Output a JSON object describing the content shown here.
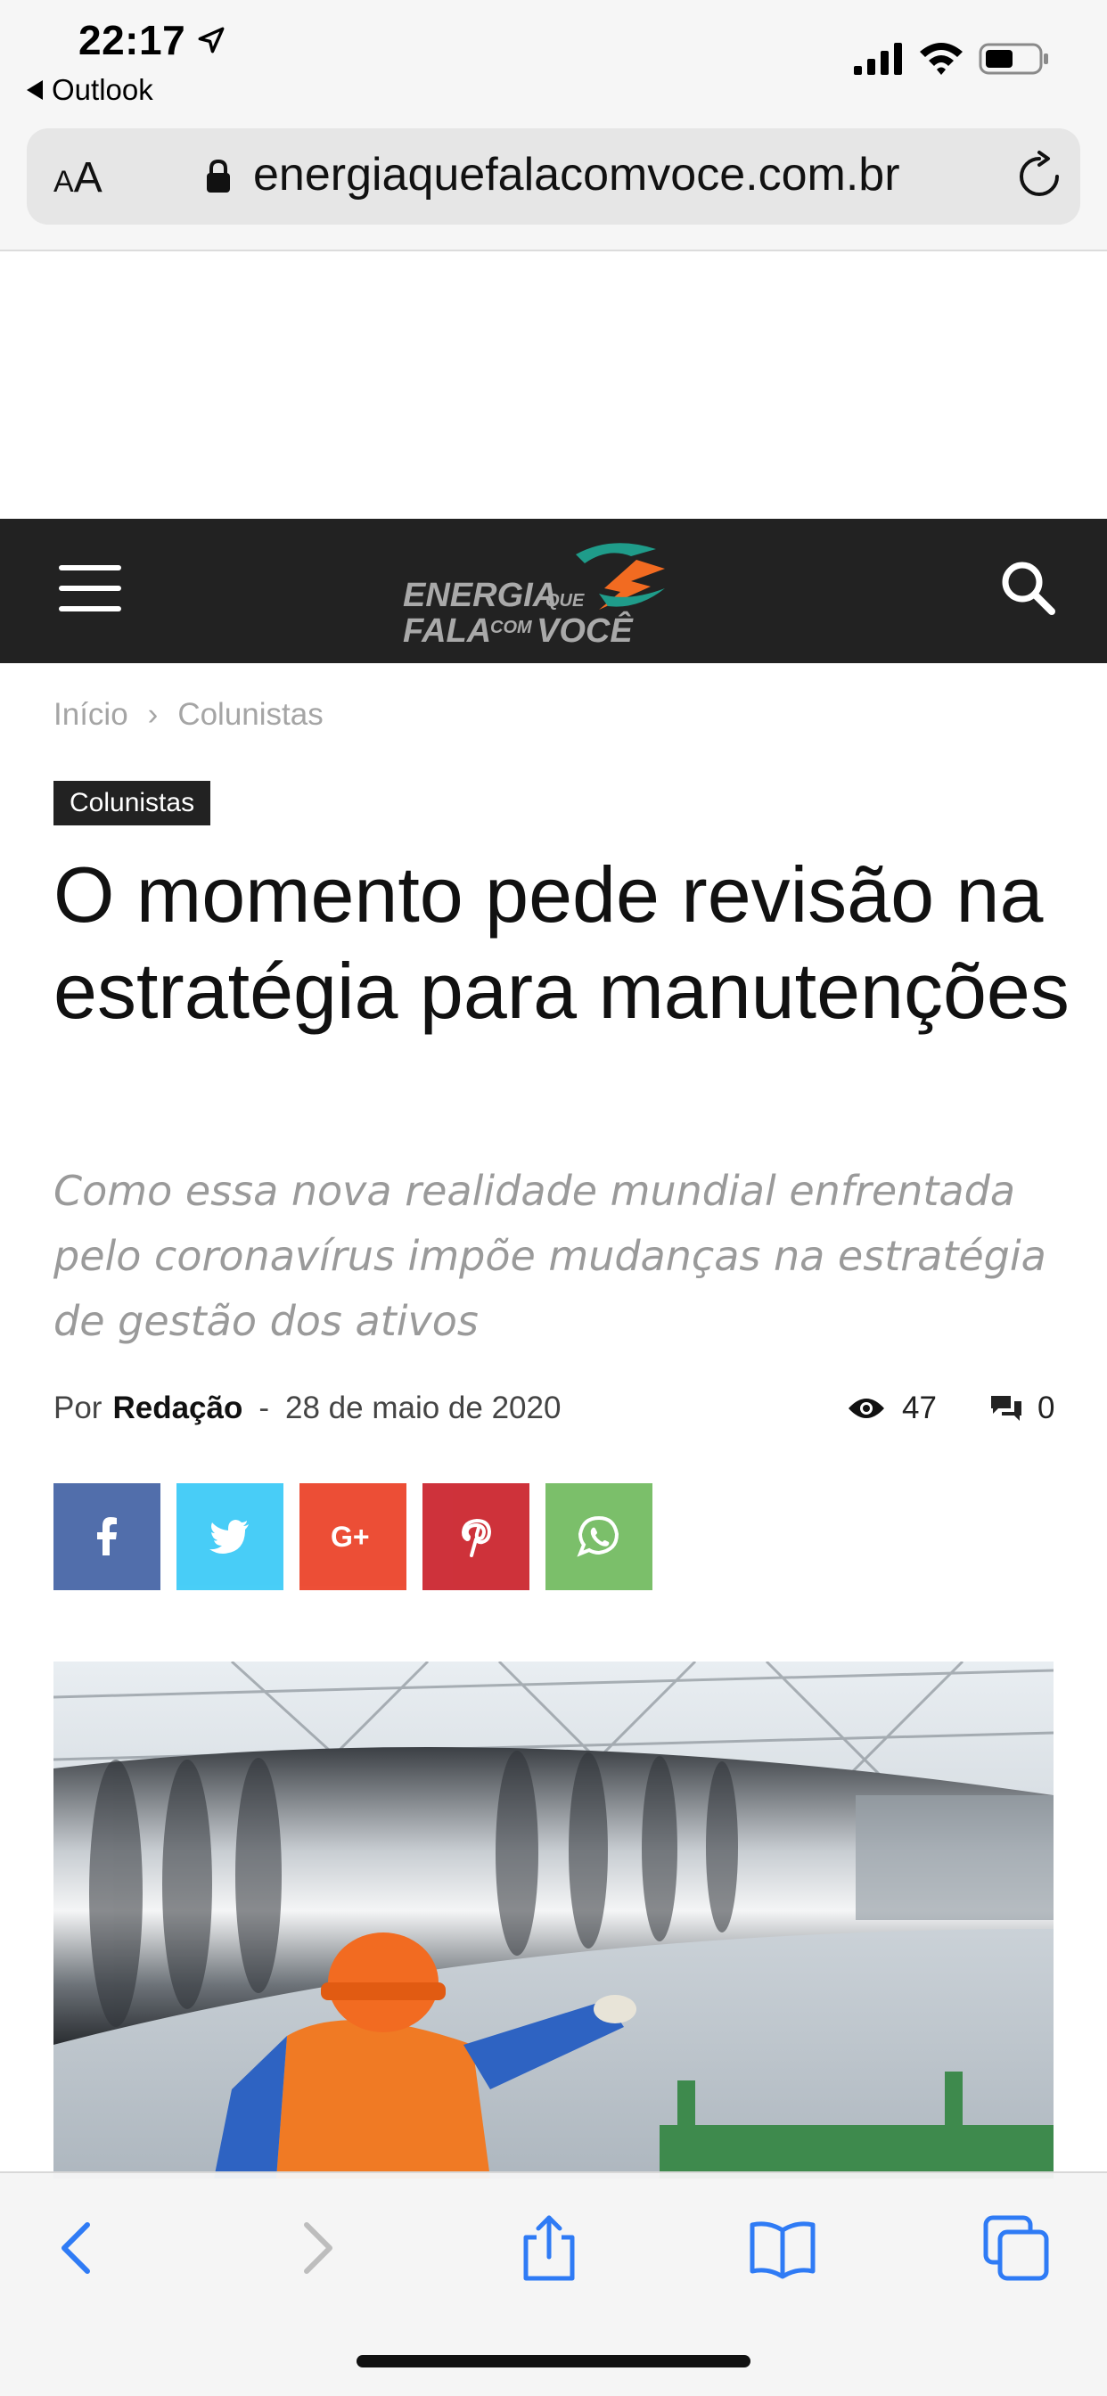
{
  "status_bar": {
    "time": "22:17",
    "back_app": "Outlook"
  },
  "address_bar": {
    "text_size_label_small": "A",
    "text_size_label_large": "A",
    "url": "energiaquefalacomvoce.com.br"
  },
  "site_header": {
    "logo_icon": "energia-que-fala-com-voce-logo"
  },
  "breadcrumb": {
    "home": "Início",
    "separator": "›",
    "current": "Colunistas"
  },
  "article": {
    "category": "Colunistas",
    "title": "O momento pede revisão na estratégia para manutenções",
    "subtitle": "Como essa nova realidade mundial enfrentada pelo coronavírus impõe mudanças na estratégia de gestão dos ativos",
    "by_label": "Por",
    "author": "Redação",
    "date_separator": "-",
    "date": "28 de maio de 2020",
    "views": "47",
    "comments": "0"
  },
  "share_buttons": [
    {
      "network": "facebook",
      "color": "#516eab"
    },
    {
      "network": "twitter",
      "color": "#29c5f6"
    },
    {
      "network": "google-plus",
      "color": "#eb4026"
    },
    {
      "network": "pinterest",
      "color": "#ca212a"
    },
    {
      "network": "whatsapp",
      "color": "#7bbf6a"
    }
  ],
  "colors": {
    "header_bg": "#222222",
    "accent_blue": "#2f7bf5",
    "logo_orange": "#f26b21",
    "logo_teal": "#1f9c8a"
  }
}
